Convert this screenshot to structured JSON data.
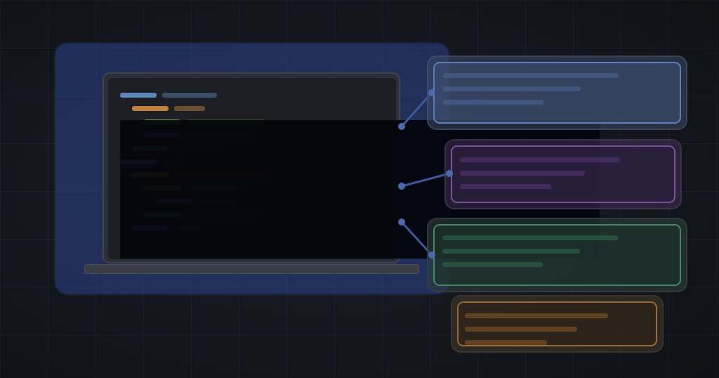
{
  "colors": {
    "background": "#15171c",
    "grid": "#2c3e78",
    "glow": "#2c448c",
    "node": "#4a6ab0",
    "link": "#3d5a98",
    "blue": "#5b86b8",
    "orange": "#c08040",
    "green": "#5a9a48",
    "purple": "#8a48b0",
    "teal": "#3a8a82"
  },
  "code_lines": [
    {
      "indent": 0,
      "tokens": [
        "blue",
        "slate"
      ]
    },
    {
      "indent": 1,
      "tokens": [
        "orange",
        "brown"
      ]
    },
    {
      "indent": 2,
      "tokens": [
        "green",
        "dkgreen"
      ]
    },
    {
      "indent": 2,
      "tokens": [
        "purple",
        "dkpurple"
      ]
    },
    {
      "indent": 1,
      "tokens": [
        "teal",
        "dkteal"
      ]
    },
    {
      "indent": 0,
      "tokens": [
        "blue",
        "dkslate"
      ]
    },
    {
      "indent": 1,
      "tokens": [
        "orange",
        "dkorange"
      ]
    },
    {
      "indent": 2,
      "tokens": [
        "green",
        "dkgreen"
      ]
    },
    {
      "indent": 3,
      "tokens": [
        "purple",
        "dkpurple"
      ]
    },
    {
      "indent": 2,
      "tokens": [
        "teal",
        "dkteal"
      ]
    },
    {
      "indent": 1,
      "tokens": [
        "blue",
        "dkslate"
      ]
    }
  ],
  "cards": [
    {
      "name": "blue-card",
      "accent": "blue"
    },
    {
      "name": "purple-card",
      "accent": "purple"
    },
    {
      "name": "green-card",
      "accent": "green"
    },
    {
      "name": "orange-card",
      "accent": "orange"
    }
  ]
}
